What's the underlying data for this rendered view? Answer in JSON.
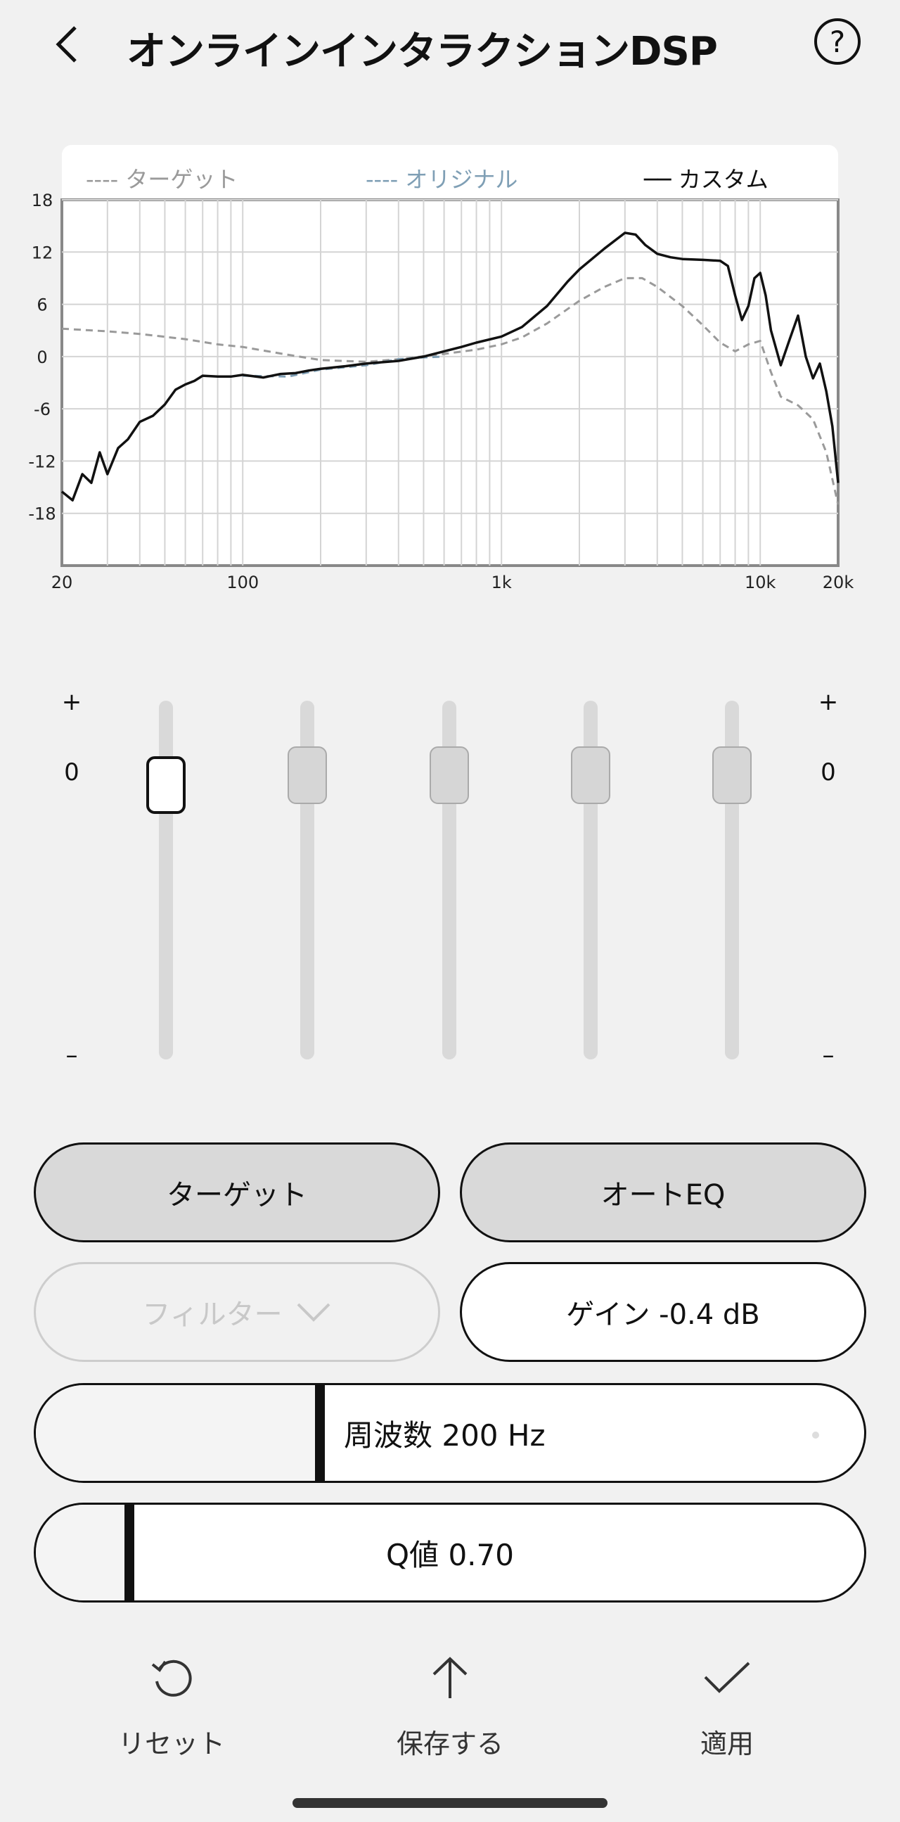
{
  "header": {
    "title": "オンラインインタラクションDSP",
    "back_icon": "chevron-left-icon",
    "help_icon": "question-circle-icon",
    "help_glyph": "?"
  },
  "chart_data": {
    "type": "line",
    "legend": [
      "---- ターゲット",
      "---- オリジナル",
      "── カスタム"
    ],
    "legend_colors": [
      "#9a9a9a",
      "#7f9fb5",
      "#111111"
    ],
    "x_scale": "log",
    "xlim": [
      20,
      20000
    ],
    "ylim": [
      -24,
      18
    ],
    "x_ticks": [
      {
        "value": 20,
        "label": "20"
      },
      {
        "value": 100,
        "label": "100"
      },
      {
        "value": 1000,
        "label": "1k"
      },
      {
        "value": 10000,
        "label": "10k"
      },
      {
        "value": 20000,
        "label": "20k"
      }
    ],
    "y_ticks": [
      18,
      12,
      6,
      0,
      -6,
      -12,
      -18
    ],
    "grid": true,
    "series": [
      {
        "name": "ターゲット",
        "style": "dashed",
        "color": "#9a9a9a",
        "x": [
          20,
          30,
          40,
          60,
          80,
          100,
          150,
          200,
          300,
          400,
          600,
          800,
          1000,
          1200,
          1500,
          2000,
          2500,
          3000,
          3500,
          4000,
          5000,
          6000,
          7000,
          8000,
          9000,
          10000,
          11000,
          12000,
          14000,
          16000,
          18000,
          20000
        ],
        "values": [
          3.2,
          2.9,
          2.6,
          2.0,
          1.4,
          1.1,
          0.2,
          -0.4,
          -0.6,
          -0.3,
          0.3,
          0.8,
          1.4,
          2.2,
          3.8,
          6.4,
          8.0,
          9.0,
          9.0,
          8.0,
          5.8,
          3.6,
          1.6,
          0.6,
          1.4,
          1.8,
          -1.8,
          -4.6,
          -5.6,
          -7.2,
          -11.0,
          -17.0
        ]
      },
      {
        "name": "オリジナル",
        "style": "dashed",
        "color": "#7f9fb5",
        "x": [
          100,
          150,
          200,
          300,
          400,
          500,
          600
        ],
        "values": [
          -2.2,
          -2.3,
          -1.5,
          -1.0,
          -0.3,
          -0.1,
          0.0
        ]
      },
      {
        "name": "カスタム",
        "style": "solid",
        "color": "#111111",
        "x": [
          20,
          22,
          24,
          26,
          28,
          30,
          33,
          36,
          40,
          45,
          50,
          55,
          60,
          65,
          70,
          80,
          90,
          100,
          120,
          140,
          160,
          180,
          200,
          250,
          300,
          400,
          500,
          600,
          700,
          800,
          1000,
          1200,
          1500,
          1800,
          2000,
          2500,
          3000,
          3300,
          3600,
          4000,
          4500,
          5000,
          6000,
          7000,
          7500,
          8000,
          8500,
          9000,
          9500,
          10000,
          10500,
          11000,
          12000,
          13000,
          14000,
          15000,
          16000,
          17000,
          18000,
          19000,
          20000
        ],
        "values": [
          -15.5,
          -16.5,
          -13.5,
          -14.5,
          -11.0,
          -13.5,
          -10.5,
          -9.5,
          -7.5,
          -6.8,
          -5.5,
          -3.8,
          -3.2,
          -2.8,
          -2.2,
          -2.3,
          -2.3,
          -2.1,
          -2.4,
          -2.0,
          -1.9,
          -1.6,
          -1.4,
          -1.1,
          -0.8,
          -0.5,
          0.0,
          0.6,
          1.1,
          1.6,
          2.3,
          3.4,
          5.8,
          8.6,
          10.0,
          12.4,
          14.2,
          14.0,
          12.8,
          11.8,
          11.4,
          11.2,
          11.1,
          11.0,
          10.4,
          7.0,
          4.2,
          5.8,
          9.0,
          9.6,
          7.0,
          3.0,
          -1.0,
          2.0,
          4.7,
          0.0,
          -2.5,
          -0.8,
          -4.0,
          -8.0,
          -14.5
        ]
      }
    ]
  },
  "eq": {
    "plus_label": "+",
    "zero_label": "0",
    "minus_label": "–",
    "selected_band": 0,
    "bands": [
      {
        "gain": 0.0
      },
      {
        "gain": 0.0
      },
      {
        "gain": 0.0
      },
      {
        "gain": 0.0
      },
      {
        "gain": 0.0
      }
    ]
  },
  "buttons": {
    "target": "ターゲット",
    "auto_eq": "オートEQ",
    "filter": "フィルター",
    "filter_icon": "chevron-down-icon",
    "gain": "ゲイン -0.4 dB"
  },
  "frequency": {
    "label": "周波数 200 Hz",
    "position": 0.337
  },
  "q_value": {
    "label": "Q値 0.70",
    "position": 0.107
  },
  "bottom_bar": {
    "reset": {
      "label": "リセット",
      "icon": "reset-icon"
    },
    "save": {
      "label": "保存する",
      "icon": "upload-arrow-icon"
    },
    "apply": {
      "label": "適用",
      "icon": "checkmark-icon"
    }
  }
}
